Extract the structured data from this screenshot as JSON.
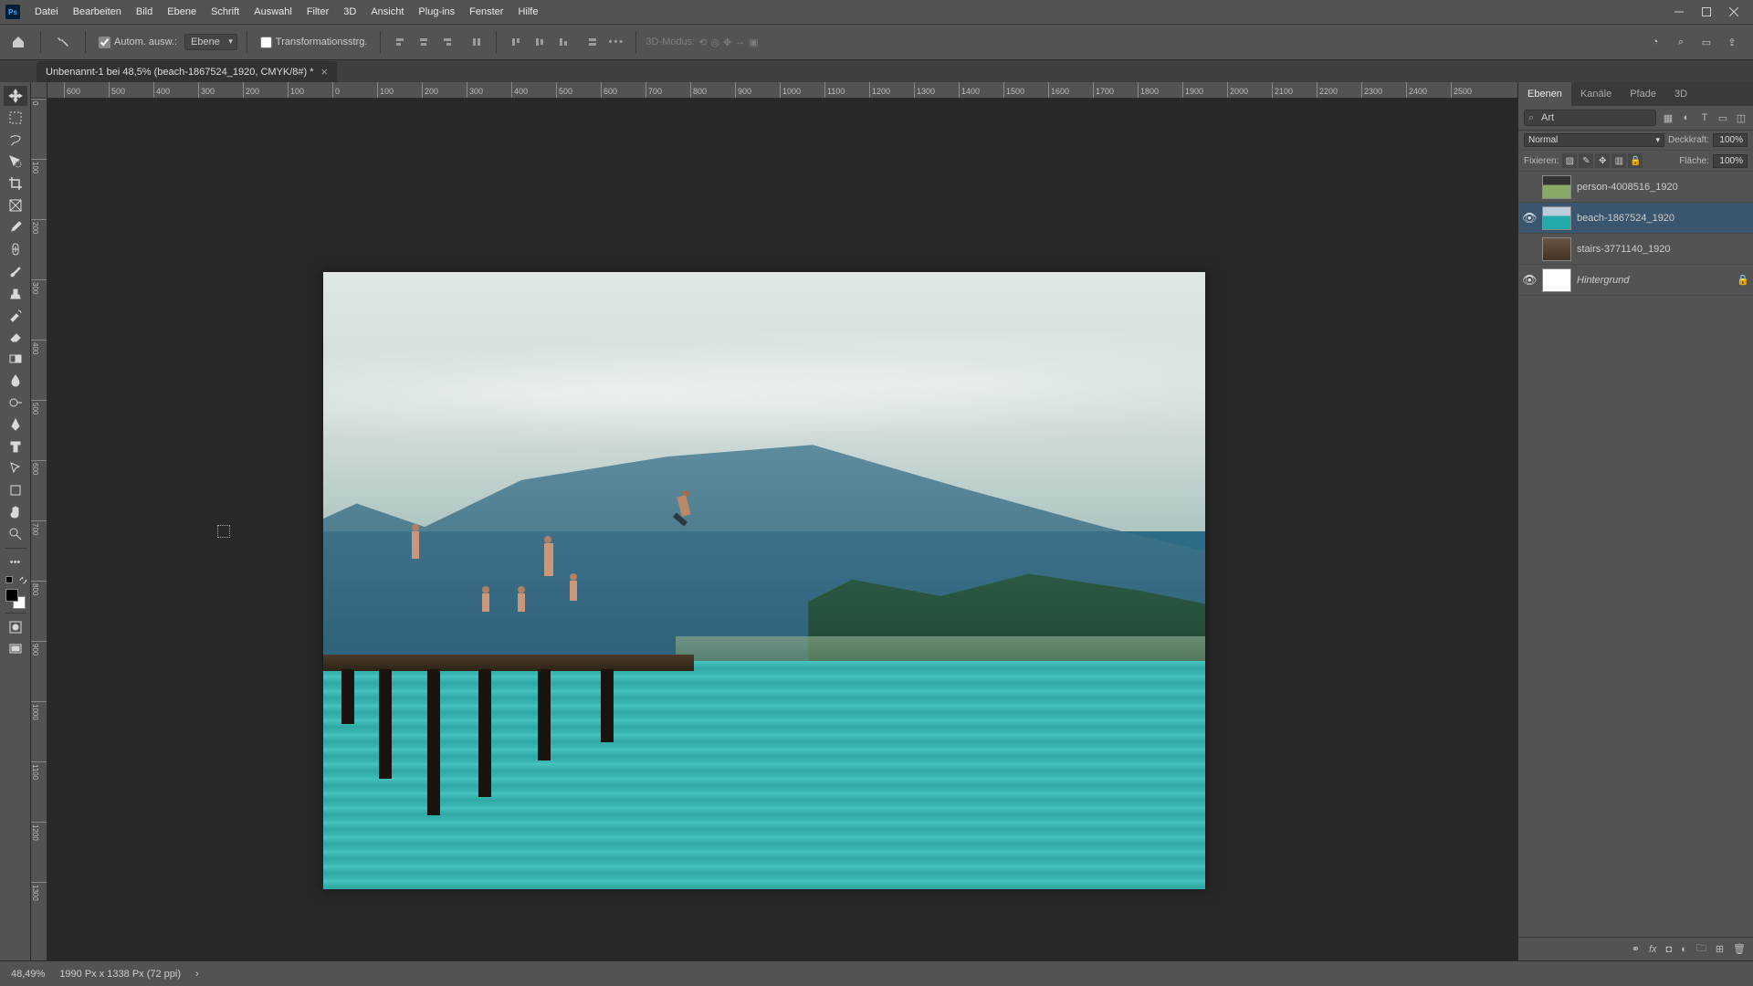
{
  "menu": {
    "items": [
      "Datei",
      "Bearbeiten",
      "Bild",
      "Ebene",
      "Schrift",
      "Auswahl",
      "Filter",
      "3D",
      "Ansicht",
      "Plug-ins",
      "Fenster",
      "Hilfe"
    ]
  },
  "options": {
    "auto_select_label": "Autom. ausw.:",
    "auto_select_target": "Ebene",
    "transform_label": "Transformationsstrg.",
    "mode3d_label": "3D-Modus:"
  },
  "document": {
    "tab_title": "Unbenannt-1 bei 48,5% (beach-1867524_1920, CMYK/8#) *"
  },
  "ruler_h": [
    "600",
    "500",
    "400",
    "300",
    "200",
    "100",
    "0",
    "100",
    "200",
    "300",
    "400",
    "500",
    "600",
    "700",
    "800",
    "900",
    "1000",
    "1100",
    "1200",
    "1300",
    "1400",
    "1500",
    "1600",
    "1700",
    "1800",
    "1900",
    "2000",
    "2100",
    "2200",
    "2300",
    "2400",
    "2500"
  ],
  "ruler_v": [
    "0",
    "100",
    "200",
    "300",
    "400",
    "500",
    "600",
    "700",
    "800",
    "900",
    "1000",
    "1100",
    "1200",
    "1300"
  ],
  "panels": {
    "tabs": [
      "Ebenen",
      "Kanäle",
      "Pfade",
      "3D"
    ],
    "search_placeholder": "Art",
    "blend_mode": "Normal",
    "opacity_label": "Deckkraft:",
    "opacity_value": "100%",
    "lock_label": "Fixieren:",
    "fill_label": "Fläche:",
    "fill_value": "100%",
    "layers": [
      {
        "name": "person-4008516_1920",
        "visible": false,
        "selected": false,
        "thumb": "img1"
      },
      {
        "name": "beach-1867524_1920",
        "visible": true,
        "selected": true,
        "thumb": "img2"
      },
      {
        "name": "stairs-3771140_1920",
        "visible": false,
        "selected": false,
        "thumb": "img3"
      },
      {
        "name": "Hintergrund",
        "visible": true,
        "selected": false,
        "thumb": "white",
        "locked": true,
        "italic": true
      }
    ]
  },
  "status": {
    "zoom": "48,49%",
    "doc_info": "1990 Px x 1338 Px (72 ppi)"
  }
}
